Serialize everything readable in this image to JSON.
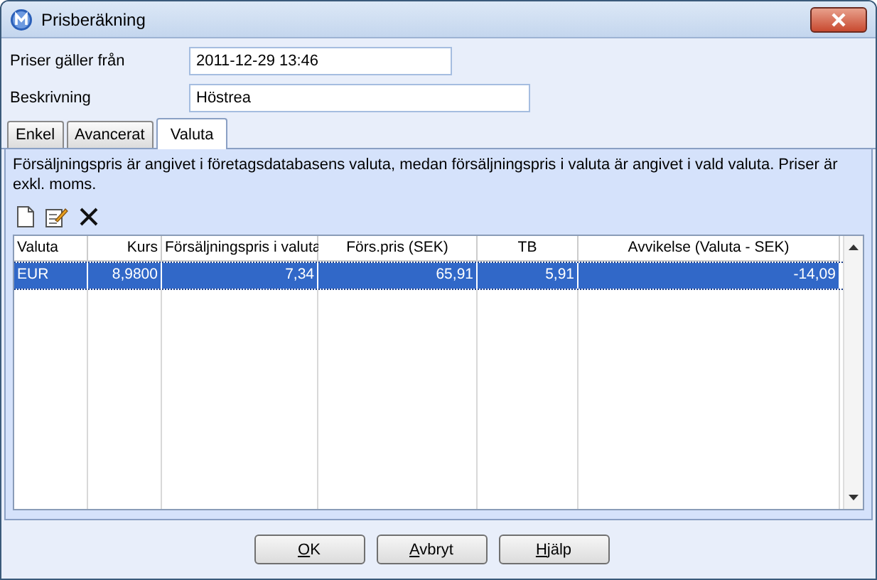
{
  "window": {
    "title": "Prisberäkning"
  },
  "fields": [
    {
      "label": "Priser gäller från",
      "value": "2011-12-29 13:46"
    },
    {
      "label": "Beskrivning",
      "value": "Höstrea"
    }
  ],
  "tabs": [
    {
      "label": "Enkel",
      "selected": false
    },
    {
      "label": "Avancerat",
      "selected": false
    },
    {
      "label": "Valuta",
      "selected": true
    }
  ],
  "info_text": "Försäljningspris är angivet i företagsdatabasens valuta, medan försäljningspris i valuta är angivet i vald valuta. Priser är exkl. moms.",
  "table": {
    "columns": [
      "Valuta",
      "Kurs",
      "Försäljningspris i valuta",
      "Förs.pris (SEK)",
      "TB",
      "Avvikelse (Valuta - SEK)"
    ],
    "rows": [
      {
        "selected": true,
        "cells": [
          "EUR",
          "8,9800",
          "7,34",
          "65,91",
          "5,91",
          "-14,09"
        ]
      }
    ]
  },
  "buttons": [
    {
      "mnemonic": "O",
      "rest": "K"
    },
    {
      "mnemonic": "A",
      "rest": "vbryt"
    },
    {
      "mnemonic": "H",
      "rest": "jälp"
    }
  ]
}
